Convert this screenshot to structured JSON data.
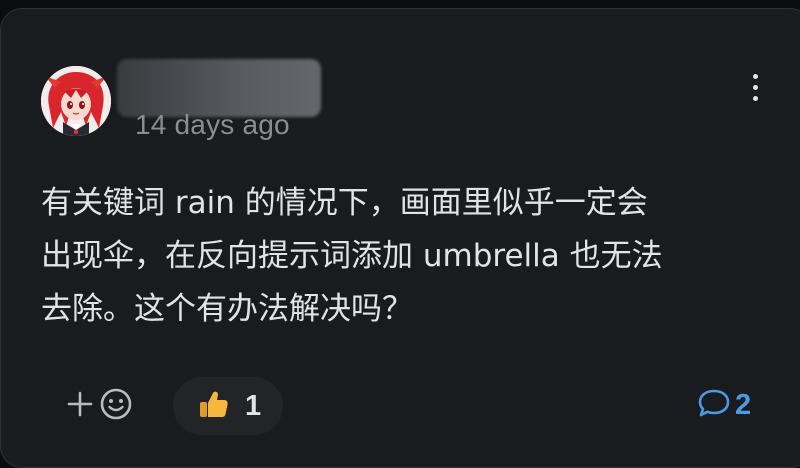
{
  "comment": {
    "timestamp": "14 days ago",
    "body": "有关键词 rain 的情况下，画面里似乎一定会\n出现伞，在反向提示词添加 umbrella 也无法\n去除。这个有办法解决吗？"
  },
  "actions": {
    "add_reaction_icon": "plus-icon",
    "emoji_icon": "smiley-icon",
    "reaction_icon": "thumbs-up-icon",
    "reaction_count": "1",
    "reply_icon": "speech-bubble-icon",
    "reply_count": "2"
  },
  "colors": {
    "card_background": "#1a1b1e",
    "text": "#e2e3e6",
    "muted": "#8b8d93",
    "accent": "#4a9ae8",
    "thumbs_up": "#f5b83d"
  }
}
